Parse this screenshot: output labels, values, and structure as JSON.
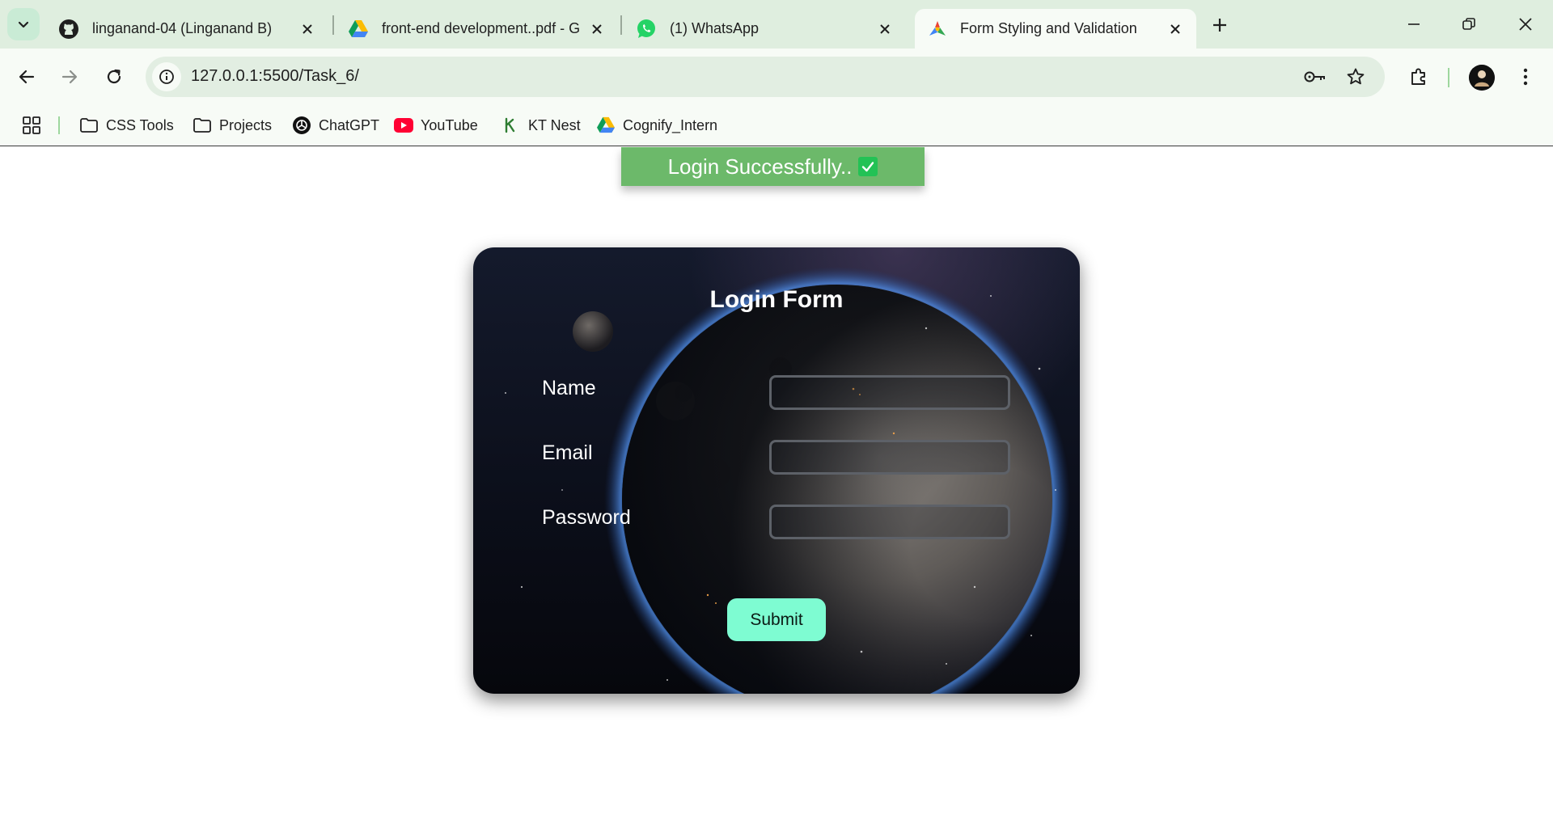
{
  "browser": {
    "tabs": [
      {
        "title": "linganand-04 (Linganand B)",
        "icon": "github-icon"
      },
      {
        "title": "front-end development..pdf - G",
        "icon": "google-drive-icon"
      },
      {
        "title": "(1) WhatsApp",
        "icon": "whatsapp-icon"
      },
      {
        "title": "Form Styling and Validation",
        "icon": "vscode-live-icon",
        "active": true
      }
    ],
    "url": "127.0.0.1:5500/Task_6/",
    "bookmarks": [
      {
        "label": "CSS Tools",
        "icon": "folder-icon"
      },
      {
        "label": "Projects",
        "icon": "folder-icon"
      },
      {
        "label": "ChatGPT",
        "icon": "chatgpt-icon"
      },
      {
        "label": "YouTube",
        "icon": "youtube-icon"
      },
      {
        "label": "KT Nest",
        "icon": "kt-nest-icon"
      },
      {
        "label": "Cognify_Intern",
        "icon": "google-drive-icon"
      }
    ],
    "colors": {
      "chrome_bg": "#dfeedf",
      "toolbar_bg": "#f7fbf6",
      "omnibox_bg": "#e2eee2"
    }
  },
  "page": {
    "toast": {
      "text": "Login Successfully..",
      "icon": "check-icon",
      "color": "#6cb96a"
    },
    "form": {
      "title": "Login Form",
      "fields": [
        {
          "label": "Name",
          "value": ""
        },
        {
          "label": "Email",
          "value": ""
        },
        {
          "label": "Password",
          "value": ""
        }
      ],
      "submit_label": "Submit",
      "submit_color": "#7efcd2"
    }
  }
}
